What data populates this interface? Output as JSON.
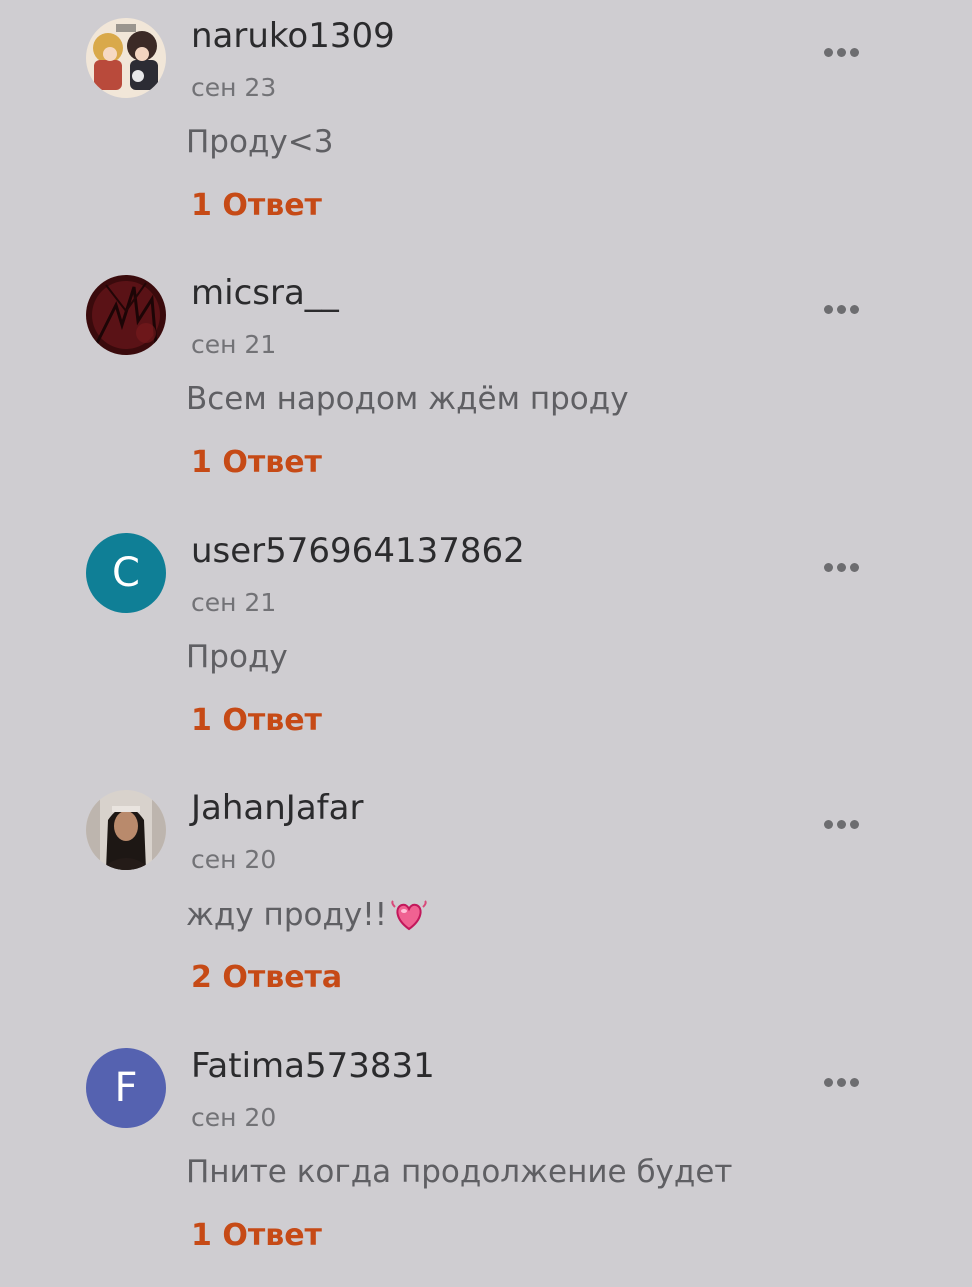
{
  "comments": [
    {
      "username": "naruko1309",
      "date": "сен 23",
      "text": "Проду<3",
      "replies": "1 Ответ",
      "avatar": {
        "type": "image",
        "icon": "anime-avatar"
      }
    },
    {
      "username": "micsra__",
      "date": "сен 21",
      "text": "Всем народом ждём проду",
      "replies": "1 Ответ",
      "avatar": {
        "type": "image",
        "icon": "dark-red-avatar"
      }
    },
    {
      "username": "user576964137862",
      "date": "сен 21",
      "text": "Проду",
      "replies": "1 Ответ",
      "avatar": {
        "type": "letter",
        "letter": "C",
        "color": "#0f7f96"
      }
    },
    {
      "username": "JahanJafar",
      "date": "сен 20",
      "text": "жду проду!!",
      "emoji": "heart-icon",
      "replies": "2 Ответа",
      "avatar": {
        "type": "image",
        "icon": "photo-avatar"
      }
    },
    {
      "username": "Fatima573831",
      "date": "сен 20",
      "text": "Пните когда продолжение будет",
      "replies": "1 Ответ",
      "avatar": {
        "type": "letter",
        "letter": "F",
        "color": "#5562b0"
      }
    }
  ],
  "colors": {
    "background": "#cfcdd1",
    "username": "#2b2b2d",
    "date": "#727276",
    "text": "#5f5f63",
    "replies_accent": "#c64a16",
    "more_dots": "#6d6d70"
  },
  "more_menu_icon": "more-options-icon"
}
